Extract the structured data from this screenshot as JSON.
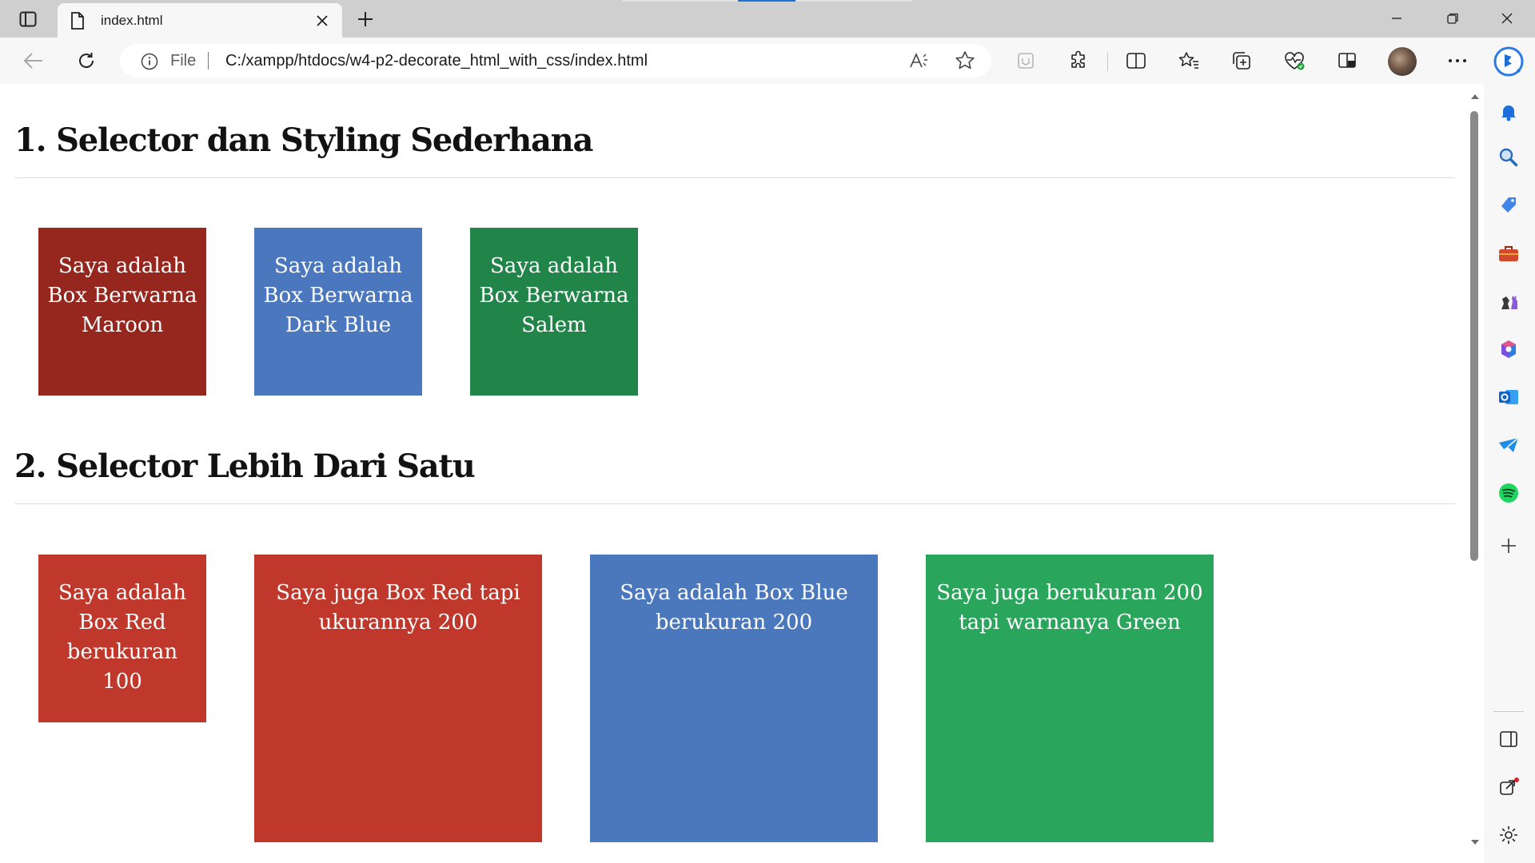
{
  "tab": {
    "title": "index.html"
  },
  "address": {
    "scheme": "File",
    "url": "C:/xampp/htdocs/w4-p2-decorate_html_with_css/index.html"
  },
  "colors": {
    "maroon_box": "#96271f",
    "darkblue_box": "#4a77bd",
    "salem_box": "#218449",
    "red_box": "#c0382c",
    "blue_box": "#4b77bd",
    "green_box": "#29a65b",
    "tab_progress": "#1f73d6"
  },
  "page": {
    "heading1": "1. Selector dan Styling Sederhana",
    "heading2": "2. Selector Lebih Dari Satu",
    "section1_boxes": [
      {
        "text": "Saya adalah Box Berwarna Maroon"
      },
      {
        "text": "Saya adalah Box Berwarna Dark Blue"
      },
      {
        "text": "Saya adalah Box Berwarna Salem"
      }
    ],
    "section2_boxes": [
      {
        "text": "Saya adalah Box Red berukuran 100"
      },
      {
        "text": "Saya juga Box Red tapi ukurannya 200"
      },
      {
        "text": "Saya adalah Box Blue berukuran 200"
      },
      {
        "text": "Saya juga berukuran 200 tapi warnanya Green"
      }
    ]
  },
  "icons": {
    "toolbar": [
      "back-icon",
      "refresh-icon",
      "read-aloud-icon",
      "favorite-star-icon",
      "browser-essentials-icon",
      "extensions-icon",
      "split-screen-icon",
      "favorites-icon",
      "collections-icon",
      "performance-icon",
      "reading-view-icon",
      "profile-avatar",
      "more-menu-icon",
      "copilot-icon"
    ],
    "sidebar": [
      "notifications-icon",
      "search-icon",
      "shopping-icon",
      "tools-icon",
      "games-icon",
      "microsoft365-icon",
      "outlook-icon",
      "telegram-icon",
      "spotify-icon",
      "add-icon",
      "hide-sidebar-icon",
      "external-link-icon",
      "settings-icon"
    ]
  }
}
